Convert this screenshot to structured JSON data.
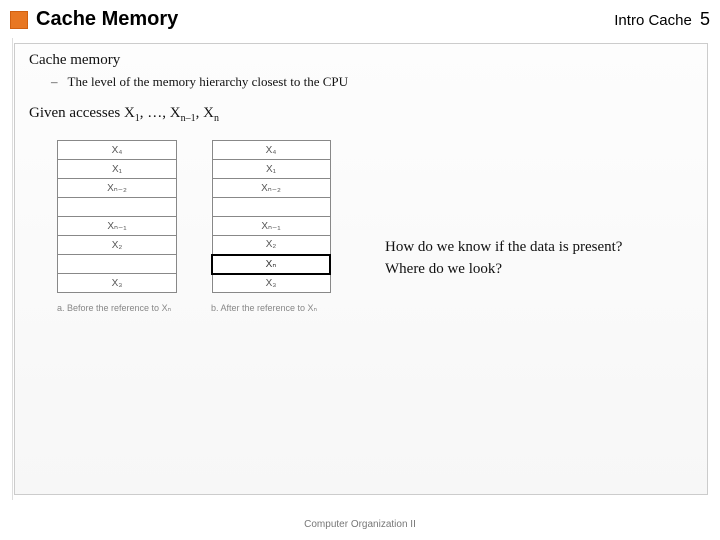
{
  "header": {
    "title": "Cache Memory",
    "section": "Intro Cache",
    "page": "5"
  },
  "subheading": "Cache memory",
  "bullet": "The level of the memory hierarchy closest to the CPU",
  "given_prefix": "Given accesses X",
  "given_mid1": ", …, X",
  "given_mid2": ", X",
  "sub1": "1",
  "sub2": "n–1",
  "sub3": "n",
  "tableA": {
    "rows": [
      "X₄",
      "X₁",
      "Xₙ₋₂",
      "",
      "Xₙ₋₁",
      "X₂",
      "",
      "X₃"
    ],
    "caption": "a. Before the reference to Xₙ"
  },
  "tableB": {
    "rows": [
      "X₄",
      "X₁",
      "Xₙ₋₂",
      "",
      "Xₙ₋₁",
      "X₂",
      "Xₙ",
      "X₃"
    ],
    "highlightIndex": 6,
    "caption": "b. After the reference to Xₙ"
  },
  "questions": {
    "q1": "How do we know if the data is present?",
    "q2": "Where do we look?"
  },
  "footer": "Computer Organization II"
}
